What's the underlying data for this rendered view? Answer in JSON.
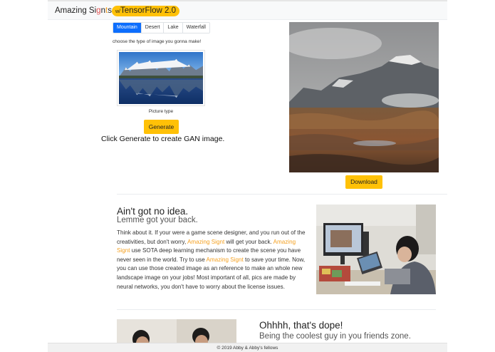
{
  "navbar": {
    "brand_prefix": "Amazing Si",
    "brand_g1": "g",
    "brand_n": "n",
    "brand_g2": "t",
    "brand_suffix": "s",
    "badge_small": "w/",
    "badge_text": "TensorFlow 2.0"
  },
  "generator": {
    "tabs": [
      "Mountain",
      "Desert",
      "Lake",
      "Waterfall"
    ],
    "active_tab": "Mountain",
    "instruction": "choose the type of image you gonna make!",
    "picture_caption": "Picture type",
    "generate_label": "Generate",
    "click_text": "Click Generate to create GAN image.",
    "download_label": "Download"
  },
  "section1": {
    "title": "Ain't got no idea.",
    "subtitle": "Lemme got your back.",
    "body": {
      "t1": "Think about it. If your were a game scene designer, and you run out of the creativities, but don't worry, ",
      "a1": "Amazing Signt",
      "t2": " will get your back. ",
      "a2": "Amazing Signt",
      "t3": " use SOTA deep learning mechanism to create the scene you have never seen in the world. Try to use ",
      "a3": "Amazing Signt",
      "t4": " to save your time. Now, you can use those created image as an reference to make an whole new landscape image on your jobs! Most important of all, pics are made by neural networks, you don't have to worry about the license issues."
    }
  },
  "section2": {
    "title": "Ohhhh, that's dope!",
    "subtitle": "Being the coolest guy in you friends zone."
  },
  "footer": {
    "text": "© 2019 Abby & Abby's fellows"
  },
  "colors": {
    "accent": "#f4a020",
    "button": "#ffc107",
    "tab_active": "#0d6efd"
  }
}
